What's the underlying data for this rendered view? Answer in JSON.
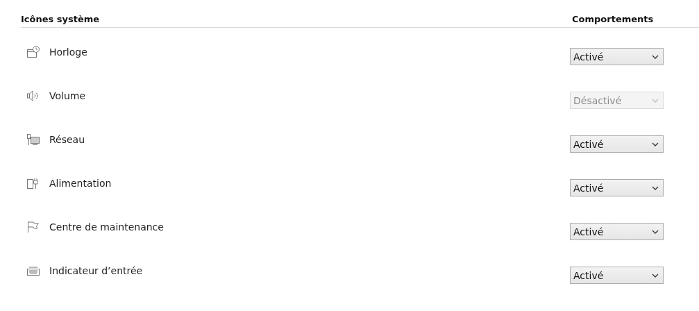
{
  "header": {
    "column_1": "Icônes système",
    "column_2": "Comportements"
  },
  "rows": [
    {
      "label": "Horloge",
      "behavior": "Activé",
      "disabled": false
    },
    {
      "label": "Volume",
      "behavior": "Désactivé",
      "disabled": true
    },
    {
      "label": "Réseau",
      "behavior": "Activé",
      "disabled": false
    },
    {
      "label": "Alimentation",
      "behavior": "Activé",
      "disabled": false
    },
    {
      "label": "Centre de maintenance",
      "behavior": "Activé",
      "disabled": false
    },
    {
      "label": "Indicateur d’entrée",
      "behavior": "Activé",
      "disabled": false
    }
  ]
}
